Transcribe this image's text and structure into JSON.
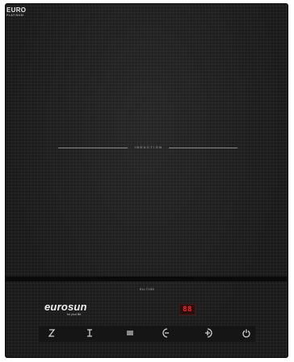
{
  "badge": {
    "line1": "EURO",
    "line2": "PLATINUM"
  },
  "cooktop": {
    "zone_label": "INDUCTION",
    "model": "EU-T155"
  },
  "brand": {
    "wordmark": "eurosun",
    "tagline": "for your life"
  },
  "display": {
    "value": "88",
    "color": "#ff2a2a"
  },
  "controls": [
    {
      "name": "child-lock-icon"
    },
    {
      "name": "timer-icon"
    },
    {
      "name": "menu-icon"
    },
    {
      "name": "minus-icon"
    },
    {
      "name": "plus-icon"
    },
    {
      "name": "power-icon"
    }
  ]
}
